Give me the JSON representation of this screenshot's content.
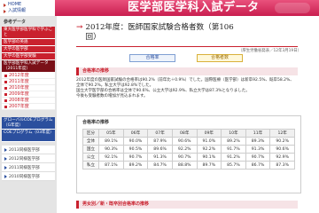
{
  "header": {
    "links": [
      "HOME",
      "入試情報"
    ],
    "banner_title": "医学部医学科入試データ",
    "side_heading": "参考データ"
  },
  "sidebar": {
    "blocks": [
      "東大医学部医学科で学ぶこと",
      "医学部の英語",
      "大学の医学部",
      "大学の医学部受験",
      "医学部医学科入試データ（2011年度）"
    ],
    "years": [
      "2012年度",
      "2011年度",
      "2010年度",
      "2009年度",
      "2008年度",
      "2007年度"
    ],
    "blue_blocks": [
      "グローバルCOEプログラム（G年度）",
      "COEプログラム（03年度）"
    ],
    "prev": [
      "2013同様医学部",
      "2012同様医学部",
      "2011同様医学部",
      "2010同様医学部"
    ]
  },
  "main": {
    "title_line1": "2012年度：医師国家試験合格者数（第106",
    "title_line2": "回）",
    "meta": "（厚生労働省発表／12年3月19日）",
    "tab_rate": "合格率",
    "tab_count": "合格者数",
    "section1": "合格率の推移",
    "body": "2012年度の医師国家試験の合格率は90.2%（前年比＋0.9%）でした。国際医療（医学部）は新卒92.5%、既卒58.2%、全体で90.2%。私立大学は92.8%でした。\n国立大学医学部の合格率は全体で90.6%、公立大学は92.9%、私立大学は87.3%となりました。\n今後も受験者数の増加が見込まれます。",
    "table_title": "合格率の推移",
    "table_headers": [
      "区分",
      "05年",
      "06年",
      "07年",
      "08年",
      "09年",
      "10年",
      "11年",
      "12年"
    ],
    "table_rows": [
      [
        "全体",
        "89.1%",
        "90.0%",
        "87.9%",
        "90.6%",
        "91.0%",
        "89.2%",
        "89.3%",
        "90.2%"
      ],
      [
        "国立",
        "90.3%",
        "90.5%",
        "89.6%",
        "92.2%",
        "92.2%",
        "91.7%",
        "91.3%",
        "90.6%"
      ],
      [
        "公立",
        "92.1%",
        "90.7%",
        "91.3%",
        "90.7%",
        "90.1%",
        "91.2%",
        "90.7%",
        "92.9%"
      ],
      [
        "私立",
        "87.1%",
        "89.2%",
        "84.7%",
        "88.8%",
        "89.7%",
        "85.7%",
        "86.7%",
        "87.3%"
      ]
    ],
    "section2": "男女別／新・既卒別合格率の推移"
  }
}
